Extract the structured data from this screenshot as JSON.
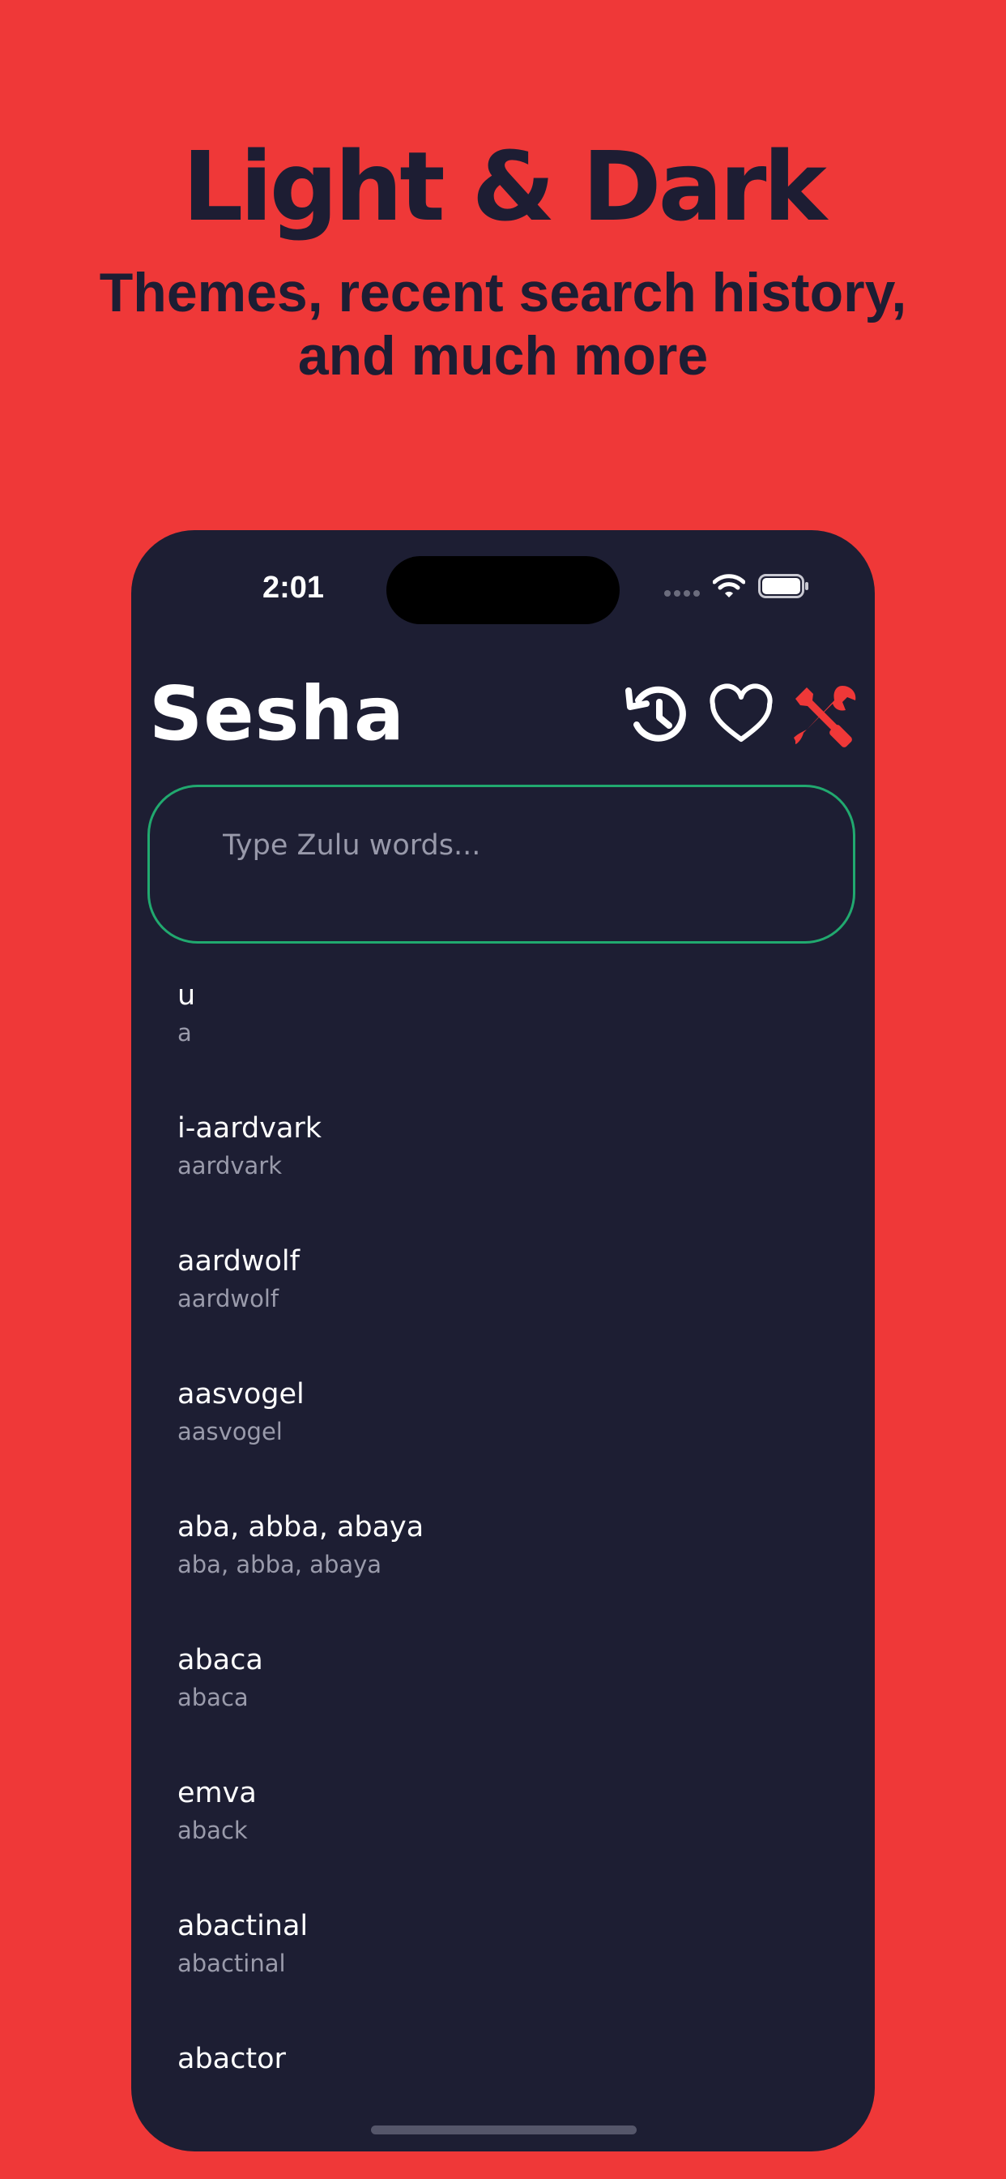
{
  "promo": {
    "headline": "Light & Dark",
    "subline_1": "Themes, recent search history,",
    "subline_2": "and much more"
  },
  "status_bar": {
    "time": "2:01"
  },
  "header": {
    "title": "Sesha",
    "icons": [
      "history-icon",
      "heart-icon",
      "tools-icon"
    ]
  },
  "search": {
    "placeholder": "Type Zulu words..."
  },
  "results": [
    {
      "word": "u",
      "translation": "a"
    },
    {
      "word": "i-aardvark",
      "translation": "aardvark"
    },
    {
      "word": "aardwolf",
      "translation": "aardwolf"
    },
    {
      "word": "aasvogel",
      "translation": "aasvogel"
    },
    {
      "word": "aba, abba, abaya",
      "translation": "aba, abba, abaya"
    },
    {
      "word": "abaca",
      "translation": "abaca"
    },
    {
      "word": "emva",
      "translation": "aback"
    },
    {
      "word": "abactinal",
      "translation": "abactinal"
    },
    {
      "word": "abactor",
      "translation": ""
    }
  ],
  "colors": {
    "background": "#ef3838",
    "phone_background": "#1d1e33",
    "accent": "#ef3838",
    "search_border": "#21a96f",
    "headline_text": "#1d1d33"
  }
}
